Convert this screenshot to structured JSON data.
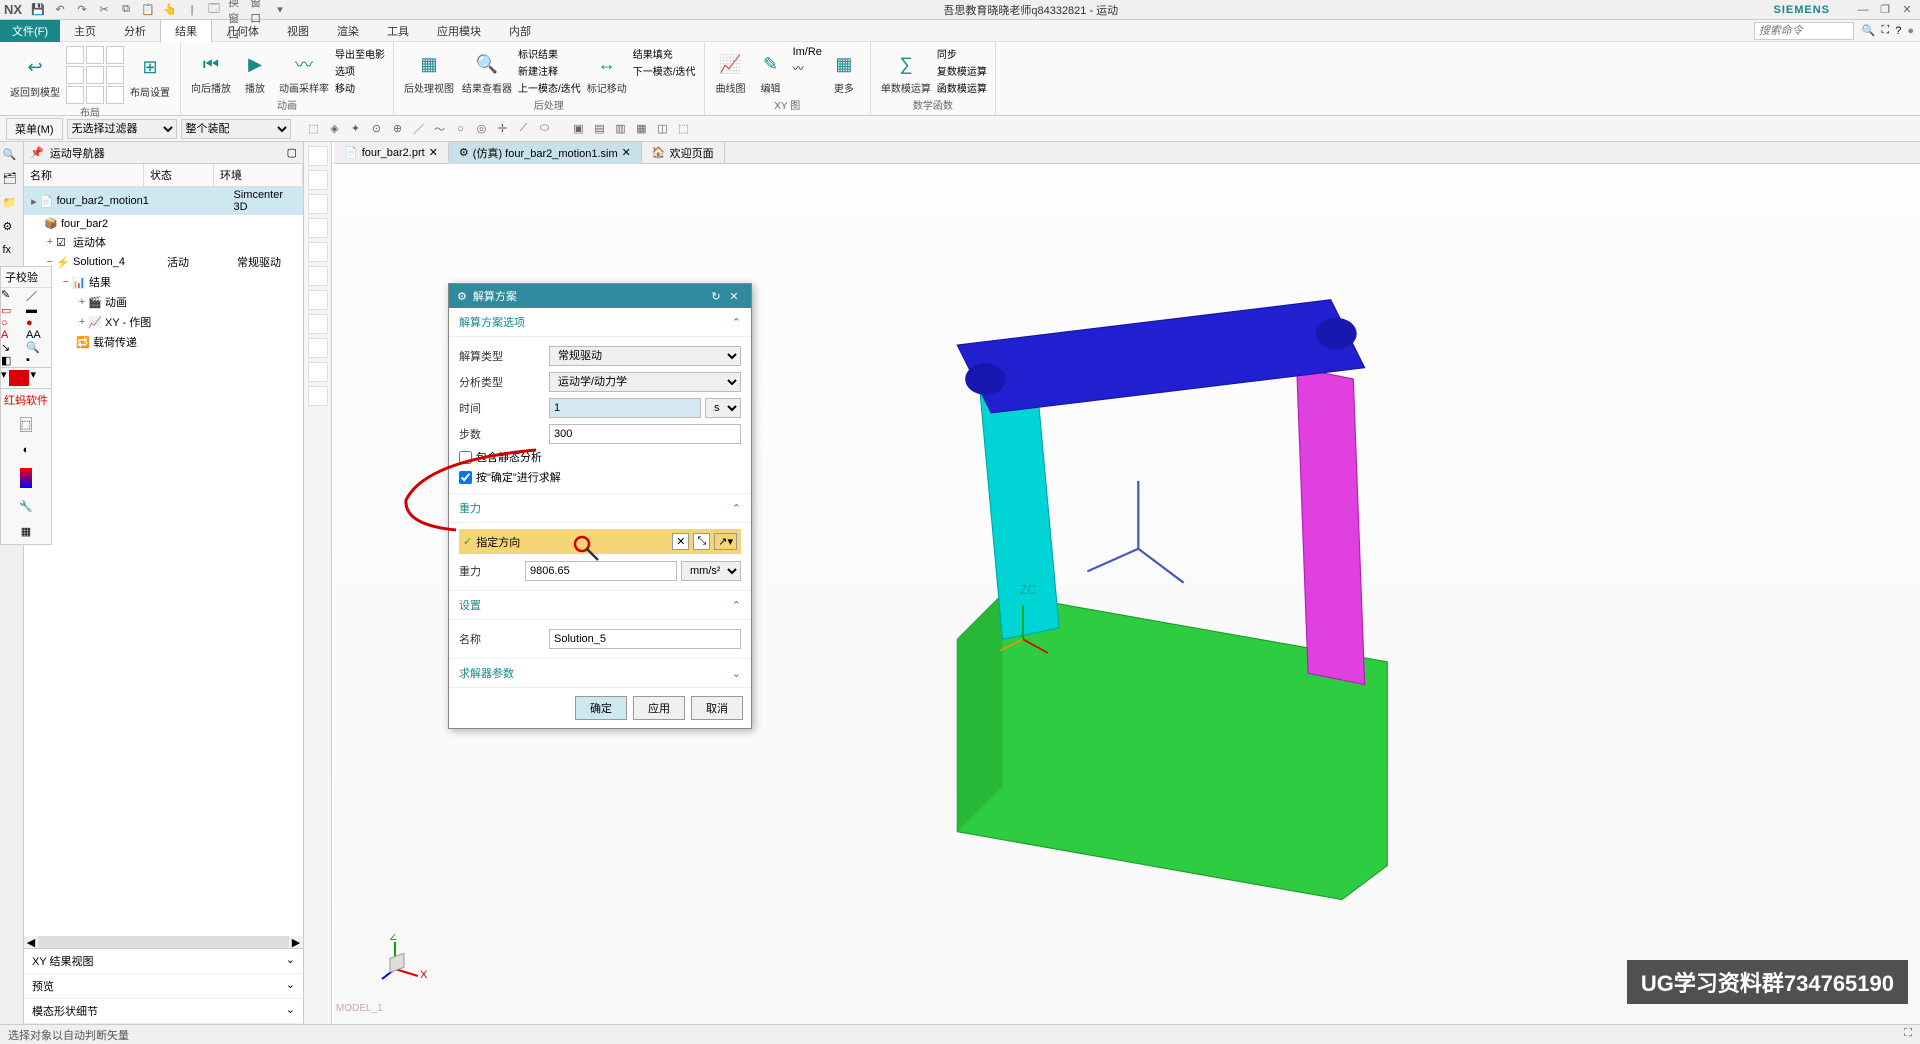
{
  "title_center": "吾思教育晓晓老师q84332821 - 运动",
  "brand": "SIEMENS",
  "nx_label": "NX",
  "qat": {
    "switch_window": "切换窗口",
    "window": "窗口"
  },
  "menu": {
    "file": "文件(F)",
    "tabs": [
      "主页",
      "分析",
      "结果",
      "几何体",
      "视图",
      "渲染",
      "工具",
      "应用模块",
      "内部"
    ],
    "active": "结果",
    "search_placeholder": "搜索命令"
  },
  "ribbon": {
    "g1": {
      "btn1": "返回到模型",
      "btn2": "布局设置",
      "label": "布局"
    },
    "g2": {
      "btn1": "向后播放",
      "btn2": "播放",
      "btn3": "动画采样率",
      "opt1": "导出至电影",
      "opt2": "选项",
      "opt3": "移动",
      "label": "动画"
    },
    "g3": {
      "btn1": "后处理视图",
      "btn2": "结果查看器",
      "opt1": "标识结果",
      "opt2": "新建注释",
      "opt3": "上一模态/迭代",
      "btn3": "标记移动",
      "opt4": "结果填充",
      "opt5": "下一模态/迭代",
      "label": "后处理"
    },
    "g4": {
      "btn1": "曲线图",
      "btn2": "编辑",
      "btn3": "更多",
      "label": "XY 图"
    },
    "g5": {
      "btn1": "单数模运算",
      "opt1": "同步",
      "opt2": "复数模运算",
      "opt3": "函数模运算",
      "label": "数学函数"
    }
  },
  "toolbar2": {
    "menu_label": "菜单(M)",
    "filter": "无选择过滤器",
    "scope": "整个装配"
  },
  "nav": {
    "title": "运动导航器",
    "cols": {
      "name": "名称",
      "status": "状态",
      "env": "环境"
    },
    "tree": {
      "root": {
        "name": "four_bar2_motion1",
        "env": "Simcenter 3D"
      },
      "n1": "four_bar2",
      "n2": "运动体",
      "n3": {
        "name": "Solution_4",
        "status": "活动",
        "env": "常规驱动"
      },
      "n4": "结果",
      "n5": "动画",
      "n6": "XY - 作图",
      "n7": "载荷传递"
    },
    "bottom": {
      "b1": "XY 结果视图",
      "b2": "预览",
      "b3": "模态形状细节"
    },
    "palette_title": "子校验",
    "palette_side": "红蚂软件"
  },
  "tabs": {
    "t1": "four_bar2.prt",
    "t2": "(仿真) four_bar2_motion1.sim",
    "t3": "欢迎页面"
  },
  "dialog": {
    "title": "解算方案",
    "sec1": "解算方案选项",
    "solve_type_lbl": "解算类型",
    "solve_type_val": "常规驱动",
    "analysis_type_lbl": "分析类型",
    "analysis_type_val": "运动学/动力学",
    "time_lbl": "时间",
    "time_val": "1",
    "time_unit": "s",
    "steps_lbl": "步数",
    "steps_val": "300",
    "chk1": "包含静态分析",
    "chk2": "按\"确定\"进行求解",
    "sec2": "重力",
    "direction": "指定方向",
    "gravity_lbl": "重力",
    "gravity_val": "9806.65",
    "gravity_unit": "mm/s²",
    "sec3": "设置",
    "name_lbl": "名称",
    "name_val": "Solution_5",
    "sec4": "求解器参数",
    "ok": "确定",
    "apply": "应用",
    "cancel": "取消"
  },
  "viewport": {
    "zc_label": "ZC",
    "model_label": "MODEL_1"
  },
  "watermark": "UG学习资料群734765190",
  "status": "选择对象以自动判断矢量"
}
